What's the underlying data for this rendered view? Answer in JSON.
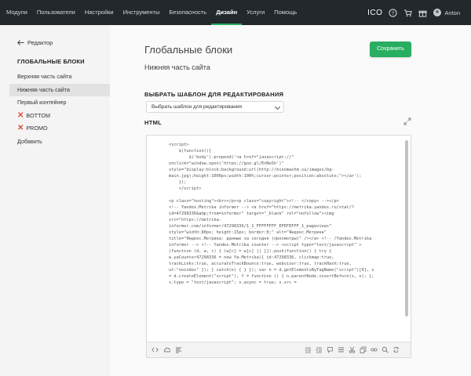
{
  "nav": {
    "items": [
      {
        "label": "Модули",
        "active": false
      },
      {
        "label": "Пользователи",
        "active": false
      },
      {
        "label": "Настройки",
        "active": false
      },
      {
        "label": "Инструменты",
        "active": false
      },
      {
        "label": "Безопасность",
        "active": false
      },
      {
        "label": "Дизайн",
        "active": true
      },
      {
        "label": "Услуги",
        "active": false
      },
      {
        "label": "Помощь",
        "active": false
      }
    ],
    "ico_label": "ICO",
    "user_name": "Anton",
    "accent_color": "#27ae60"
  },
  "sidebar": {
    "back_label": "Редактор",
    "title": "ГЛОБАЛЬНЫЕ БЛОКИ",
    "items": [
      {
        "label": "Верхняя часть сайта",
        "active": false,
        "disabled": false
      },
      {
        "label": "Нижняя часть сайта",
        "active": true,
        "disabled": false
      },
      {
        "label": "Первый контейнер",
        "active": false,
        "disabled": false
      },
      {
        "label": "BOTTOM",
        "active": false,
        "disabled": true
      },
      {
        "label": "PROMO",
        "active": false,
        "disabled": true
      },
      {
        "label": "Добавить",
        "active": false,
        "disabled": false
      }
    ]
  },
  "main": {
    "title": "Глобальные блоки",
    "subtitle": "Нижняя часть сайта",
    "save_label": "Сохранить",
    "template_label": "ВЫБРАТЬ ШАБЛОН ДЛЯ РЕДАКТИРОВАНИЯ",
    "template_select_value": "Выбрать шаблон для редактирования",
    "html_label": "HTML"
  },
  "editor": {
    "lines": [
      "<script>",
      "    $(function(){",
      "        $('body').prepend('<a href=\"javascript://\"",
      "onclick=\"window.open('https://goo.gl/EnNuSh')\"",
      "style=\"display:block;background:url(http://kinomaxhd.su/images/bg-",
      "main.jpg);height:1000px;width:100%;cursor:pointer;position:absolute;\"></a>');",
      "    });",
      "    </script>",
      "",
      "<p class=\"hosting\"><br></p><p class=\"copyright\"><!-- </copy> --></p>",
      "<!-- Yandex.Metrika informer --> <a href=\"https://metrika.yandex.ru/stat/?",
      "id=47298336&amp;from=informer\" target=\"_blank\" rel=\"nofollow\"><img",
      "src=\"https://metrika-",
      "informer.com/informer/47298336/1_1_FFFFFFFF_EFEFEFFF_1_pageviews\"",
      "style=\"width:80px; height:15px; border:0;\" alt=\"Яндекс.Метрика\"",
      "title=\"Яндекс.Метрика: данные за сегодня (просмотры)\" /></a> <!-- /Yandex.Metrika",
      "informer --> <!-- Yandex.Metrika counter --> <script type=\"text/javascript\" >",
      "(function (d, w, c) { (w[c] = w[c] || []).push(function() { try {",
      "w.yaCounter47298336 = new Ya.Metrika({ id:47298336, clickmap:true,",
      "trackLinks:true, accurateTrackBounce:true, webvisor:true, trackHash:true,",
      "ut:\"noindex\" }); } catch(e) { } }); var n = d.getElementsByTagName(\"script\")[0], s",
      "= d.createElement(\"script\"), f = function () { n.parentNode.insertBefore(s, n); };",
      "s.type = \"text/javascript\"; s.async = true; s.src ="
    ],
    "toolbar_left_icons": [
      "code-icon",
      "cloud-icon",
      "align-left-icon"
    ],
    "toolbar_right_icons": [
      "indent-icon",
      "outdent-icon",
      "comment-icon",
      "format-icon",
      "cut-icon",
      "copy-icon",
      "link-icon",
      "search-icon",
      "replace-icon"
    ]
  }
}
